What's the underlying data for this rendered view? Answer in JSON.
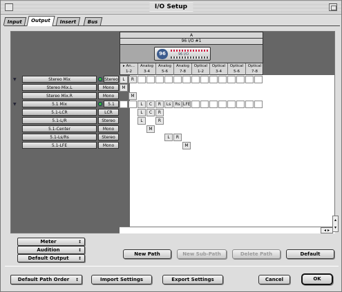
{
  "window": {
    "title": "I/O Setup"
  },
  "tabs": [
    "Input",
    "Output",
    "Insert",
    "Bus"
  ],
  "io_group": {
    "name": "A",
    "device": "96 I/O #1",
    "device_badge": "96",
    "device_caption": "96 I/O"
  },
  "columns": [
    {
      "top": "▸ An...",
      "bottom": "1-2"
    },
    {
      "top": "Analog",
      "bottom": "3-4"
    },
    {
      "top": "Analog",
      "bottom": "5-6"
    },
    {
      "top": "Analog",
      "bottom": "7-8"
    },
    {
      "top": "Optical",
      "bottom": "1-2"
    },
    {
      "top": "Optical",
      "bottom": "3-4"
    },
    {
      "top": "Optical",
      "bottom": "5-6"
    },
    {
      "top": "Optical",
      "bottom": "7-8"
    }
  ],
  "paths": [
    {
      "name": "Stereo Mix",
      "format": "Stereo",
      "main": true
    },
    {
      "name": "Stereo Mix.L",
      "format": "Mono",
      "main": false
    },
    {
      "name": "Stereo Mix.R",
      "format": "Mono",
      "main": false
    },
    {
      "name": "5.1 Mix",
      "format": "5.1",
      "main": true
    },
    {
      "name": "5.1-LCR",
      "format": "LCR",
      "main": false
    },
    {
      "name": "5.1-L/R",
      "format": "Stereo",
      "main": false
    },
    {
      "name": "5.1-Center",
      "format": "Mono",
      "main": false
    },
    {
      "name": "5.1-Ls/Rs",
      "format": "Stereo",
      "main": false
    },
    {
      "name": "5.1-LFE",
      "format": "Mono",
      "main": false
    }
  ],
  "assignments": [
    "L",
    "R",
    "M",
    "M",
    "L",
    "C",
    "R",
    "Ls",
    "Rs",
    "LFE",
    "L",
    "C",
    "R",
    "L",
    "R",
    "M",
    "L",
    "R",
    "M"
  ],
  "left_popups": {
    "meter": "Meter",
    "audition": "Audition",
    "default_output": "Default Output"
  },
  "path_buttons": {
    "new_path": "New Path",
    "new_sub_path": "New Sub-Path",
    "delete_path": "Delete Path",
    "default": "Default"
  },
  "footer": {
    "default_path_order": "Default Path Order",
    "import": "Import Settings",
    "export": "Export Settings",
    "cancel": "Cancel",
    "ok": "OK"
  },
  "icons": {
    "popup_arrow": "↕",
    "disclosure": "▼",
    "scroll_left": "◂",
    "scroll_right": "▸",
    "scroll_up": "▴",
    "scroll_down": "▾"
  }
}
